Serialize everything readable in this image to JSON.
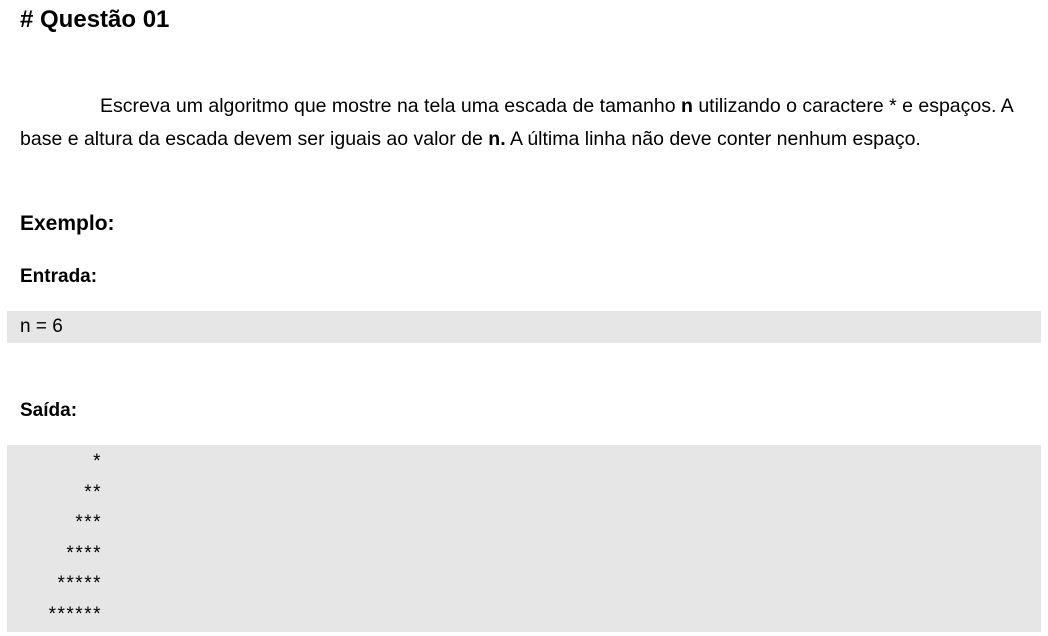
{
  "title": "# Questão 01",
  "description": {
    "part1": "Escreva um algoritmo que mostre na tela uma escada de tamanho ",
    "n1": "n",
    "part2": " utilizando o caractere * e espaços. A base e altura da escada devem ser iguais ao valor de ",
    "n2": "n.",
    "part3": " A última linha não deve conter nenhum espaço."
  },
  "example_heading": "Exemplo:",
  "input_heading": "Entrada:",
  "input_value": "n = 6",
  "output_heading": "Saída:",
  "output_lines": [
    "*",
    "**",
    "***",
    "****",
    "*****",
    "******"
  ],
  "colors": {
    "code_background": "#e6e6e6",
    "text": "#000000"
  }
}
